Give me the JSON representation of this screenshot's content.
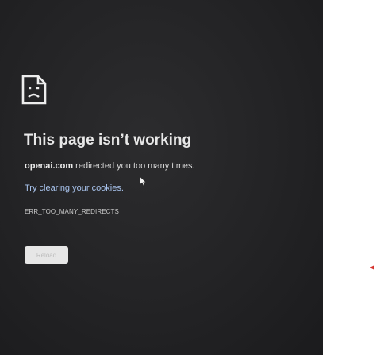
{
  "error_page": {
    "icon": "sad-page-icon",
    "title": "This page isn’t working",
    "domain": "openai.com",
    "message_rest": " redirected you too many times.",
    "suggestion": "Try clearing your cookies.",
    "error_code": "ERR_TOO_MANY_REDIRECTS",
    "reload_label": "Reload"
  },
  "colors": {
    "background": "#232325",
    "text": "#e8e8e8",
    "link": "#a9c4ee",
    "button": "#e6e6e6"
  }
}
